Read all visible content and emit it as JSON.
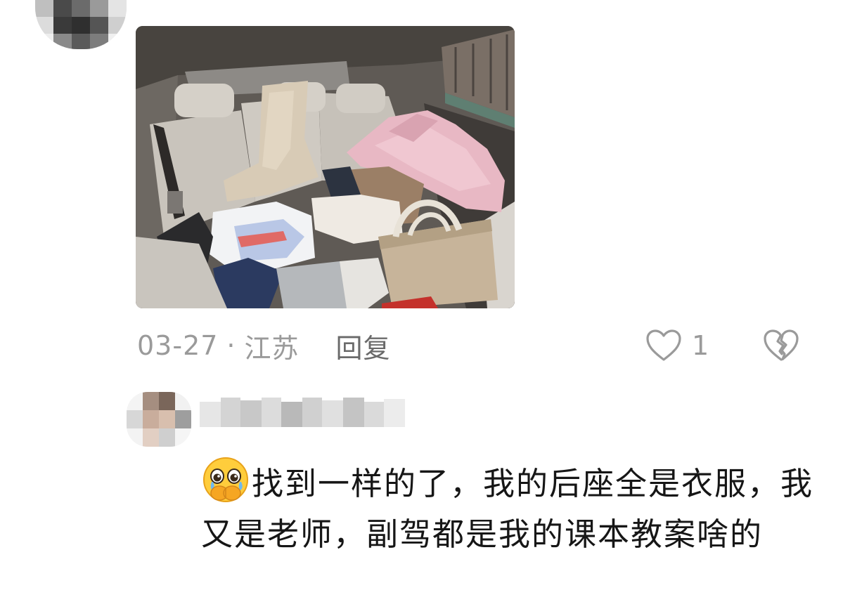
{
  "top_comment": {
    "date": "03-27",
    "separator": "·",
    "location": "江苏",
    "reply_label": "回复",
    "like_count": "1",
    "icons": {
      "like": "heart-outline-icon",
      "dislike": "broken-heart-icon"
    }
  },
  "reply_comment": {
    "emoji": "pleading-face-emoji",
    "text": "找到一样的了，我的后座全是衣服，我又是老师，副驾都是我的课本教案啥的"
  },
  "colors": {
    "meta_gray": "#9a9a9a",
    "text_dark": "#161616",
    "background": "#ffffff"
  }
}
